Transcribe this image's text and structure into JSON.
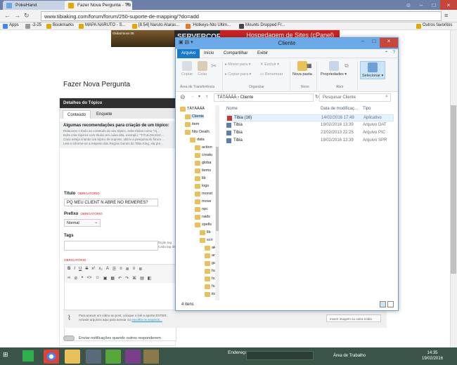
{
  "browser": {
    "tabs": [
      {
        "label": "PokeHand"
      },
      {
        "label": "Fazer Nova Pergunta - Tib"
      }
    ],
    "url": "www.tibiaking.com/forum/forum/250-suporte-de-mapping/?do=add",
    "bookmarks": [
      {
        "label": "Apps",
        "color": "#4285f4"
      },
      {
        "label": "-2-25",
        "color": "#999"
      },
      {
        "label": "Bookmarks",
        "color": "#e0a800"
      },
      {
        "label": "MAPA NARUTO - S...",
        "color": "#e0a800"
      },
      {
        "label": "[8.54] Naruto Ataras...",
        "color": "#e0a800"
      },
      {
        "label": ":Hotkeys-Nto Ultim...",
        "color": "#e87722"
      },
      {
        "label": "Mounts Dropped Fr...",
        "color": "#444"
      }
    ],
    "other_bookmarks": "Outros favoritos"
  },
  "page": {
    "banner_left": "Global Boss 08",
    "banner_text": "SERVERCORE",
    "banner_red": "Hospedagem de Sites (cPanel)",
    "title": "Fazer Nova Pergunta",
    "details_heading": "Detalhes do Tópico",
    "tabs": [
      "Conteúdo",
      "Enquete"
    ],
    "recs_title": "Algumas recomendações para criação de um tópico:",
    "recs": [
      "Relacione o título ao conteúdo do seu tópico, evite títulos como \"Aj...",
      "Evite criar tópicos com títulos em caixa alta, exemplo: \"TITULOS ESC...",
      "Caso esteja criando um tópico de suporte, utilize a pesquisa do fórum...",
      "Leia e informe-se a respeito das Regras Gerais do Tibia King, ela pre..."
    ],
    "title_label": "Título",
    "required": "OBRIGATÓRIO",
    "title_value": "PQ MEU CLIENT N ABRE NO REMERES?",
    "prefix_label": "Prefixo",
    "prefix_value": "Normal",
    "tags_label": "Tags",
    "tags_hint": "Digite tag\nCada tag de",
    "editor_required": "OBRIGATÓRIO",
    "footer_note": "Para anexar um vídeo ao post, coloque o link e aperte ENTER.",
    "footer_note2": "Arraste arquivos aqui para anexar ou",
    "footer_link": "escolha os arquivos...",
    "insert_button": "Inserir imagem ou outra mídia",
    "notify": "Enviar notificações quando outros responderem"
  },
  "explorer": {
    "title": "Cliente",
    "ribbon_tabs": [
      "Arquivo",
      "Início",
      "Compartilhar",
      "Exibir"
    ],
    "clipboard_buttons": [
      "Copiar",
      "Colar"
    ],
    "clipboard_group": "Área de Transferência",
    "organize_buttons": [
      "Mover para",
      "Copiar para",
      "Excluir",
      "Renomear"
    ],
    "organize_group": "Organizar",
    "new_button": "Nova pasta",
    "new_group": "Novo",
    "open_button": "Propriedades",
    "open_group": "Abrir",
    "select_button": "Selecionar",
    "breadcrumb": "TÄTÄÄÄÄ  ›  Cliente",
    "search_placeholder": "Pesquisar Cliente",
    "columns": [
      "Nome",
      "Data de modificaç...",
      "Tipo"
    ],
    "files": [
      {
        "name": "Tibia (16)",
        "date": "14/02/2016 17:49",
        "type": "Aplicativo",
        "icon_color": "#c0392b"
      },
      {
        "name": "Tibia",
        "date": "19/02/2016 13:39",
        "type": "Arquivo DAT",
        "icon_color": "#5b7fb0"
      },
      {
        "name": "Tibia",
        "date": "21/02/2013 22:25",
        "type": "Arquivo PIC",
        "icon_color": "#5b7fb0"
      },
      {
        "name": "Tibia",
        "date": "19/02/2016 13:39",
        "type": "Arquivo SPR",
        "icon_color": "#5b7fb0"
      }
    ],
    "tree": [
      {
        "label": "TÄTÄÄÄÄ",
        "indent": 0
      },
      {
        "label": "Cliente",
        "indent": 1,
        "selected": true
      },
      {
        "label": "item",
        "indent": 1
      },
      {
        "label": "Nto Death",
        "indent": 1
      },
      {
        "label": "data",
        "indent": 2
      },
      {
        "label": "action",
        "indent": 3
      },
      {
        "label": "creatu",
        "indent": 3
      },
      {
        "label": "globa",
        "indent": 3
      },
      {
        "label": "items",
        "indent": 3
      },
      {
        "label": "lib",
        "indent": 3
      },
      {
        "label": "logs",
        "indent": 3
      },
      {
        "label": "monst",
        "indent": 3
      },
      {
        "label": "move",
        "indent": 3
      },
      {
        "label": "npc",
        "indent": 3
      },
      {
        "label": "raids",
        "indent": 3
      },
      {
        "label": "spells",
        "indent": 3
      },
      {
        "label": "lib",
        "indent": 4
      },
      {
        "label": "scri",
        "indent": 4
      },
      {
        "label": "ak",
        "indent": 5
      },
      {
        "label": "ar",
        "indent": 5
      },
      {
        "label": "ga",
        "indent": 5
      },
      {
        "label": "ha",
        "indent": 5
      },
      {
        "label": "hu",
        "indent": 5
      },
      {
        "label": "hu",
        "indent": 5
      },
      {
        "label": "itc",
        "indent": 5
      }
    ],
    "status": "4 itens"
  },
  "taskbar": {
    "search_label": "Endereço",
    "desktop_label": "Área de Trabalho",
    "time": "14:35",
    "date": "19/02/2016"
  }
}
